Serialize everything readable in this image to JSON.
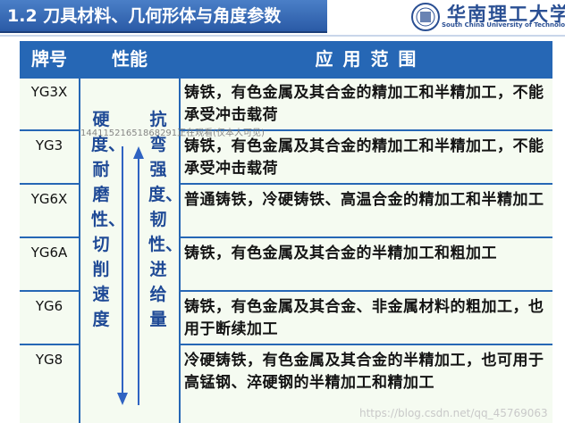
{
  "header": {
    "title": "1.2 刀具材料、几何形体与角度参数",
    "logo_cn": "华南理工大学",
    "logo_en": "South China University of Technology"
  },
  "table": {
    "headers": [
      "牌号",
      "性能",
      "应 用 范 围"
    ],
    "rows": [
      {
        "grade": "YG3X",
        "application": "铸铁，有色金属及其合金的精加工和半精加工，不能承受冲击载荷"
      },
      {
        "grade": "YG3",
        "application": "铸铁，有色金属及其合金的精加工和半精加工，不能承受冲击载荷"
      },
      {
        "grade": "YG6X",
        "application": "普通铸铁，冷硬铸铁、高温合金的精加工和半精加工"
      },
      {
        "grade": "YG6A",
        "application": "铸铁，有色金属及其合金的半精加工和粗加工"
      },
      {
        "grade": "YG6",
        "application": "铸铁，有色金属及其合金、非金属材料的粗加工，也用于断续加工"
      },
      {
        "grade": "YG8",
        "application": "冷硬铸铁，有色金属及其合金的半精加工，也可用于高锰钢、淬硬钢的半精加工和精加工"
      }
    ],
    "performance_left": "硬度、耐磨性、切削速度",
    "performance_right": "抗弯强度、韧性、进给量"
  },
  "overlay": {
    "watermark": "14411521651868291正在观看(仅本人可见)",
    "csdn": "https://blog.csdn.net/qq_45769063"
  },
  "colors": {
    "header_blue": "#2667b5",
    "cell_bg": "#f5fbf1"
  }
}
